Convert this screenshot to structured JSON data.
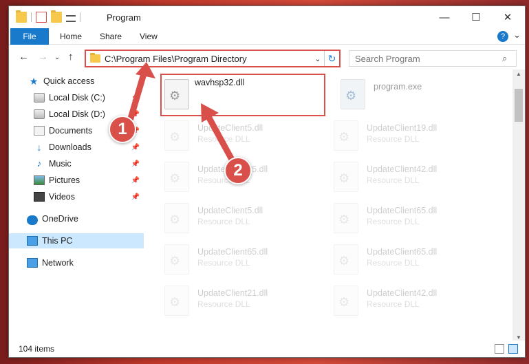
{
  "window": {
    "title": "Program",
    "minimize_glyph": "—",
    "maximize_glyph": "☐",
    "close_glyph": "✕"
  },
  "ribbon": {
    "tabs": [
      "File",
      "Home",
      "Share",
      "View"
    ],
    "expand_glyph": "⌄",
    "help_glyph": "?"
  },
  "navigation": {
    "back_glyph": "←",
    "forward_glyph": "→",
    "recent_glyph": "⌄",
    "up_glyph": "↑"
  },
  "address": {
    "path": "C:\\Program Files\\Program Directory",
    "dropdown_glyph": "⌄",
    "refresh_glyph": "↻"
  },
  "search": {
    "placeholder": "Search Program",
    "icon_glyph": "⌕"
  },
  "sidebar": {
    "items": [
      {
        "label": "Quick access",
        "icon": "star-icon",
        "pinned": false
      },
      {
        "label": "Local Disk (C:)",
        "icon": "disk-icon",
        "pinned": true
      },
      {
        "label": "Local Disk (D:)",
        "icon": "disk-icon",
        "pinned": true
      },
      {
        "label": "Documents",
        "icon": "documents-icon",
        "pinned": true
      },
      {
        "label": "Downloads",
        "icon": "downloads-icon",
        "pinned": true
      },
      {
        "label": "Music",
        "icon": "music-icon",
        "pinned": true
      },
      {
        "label": "Pictures",
        "icon": "pictures-icon",
        "pinned": true
      },
      {
        "label": "Videos",
        "icon": "videos-icon",
        "pinned": true
      },
      {
        "label": "OneDrive",
        "icon": "onedrive-icon",
        "pinned": false
      },
      {
        "label": "This PC",
        "icon": "this-pc-icon",
        "pinned": false,
        "selected": true
      },
      {
        "label": "Network",
        "icon": "network-icon",
        "pinned": false
      }
    ],
    "pin_glyph": "📌",
    "star_glyph": "★",
    "download_glyph": "↓",
    "music_glyph": "♪"
  },
  "files": {
    "highlighted": {
      "name": "wavhsp32.dll",
      "type": ""
    },
    "exe": {
      "name": "program.exe",
      "type": ""
    },
    "faded": [
      {
        "name": "UpdateClient5.dll",
        "type": "Resource DLL"
      },
      {
        "name": "UpdateClient19.dll",
        "type": "Resource DLL"
      },
      {
        "name": "UpdateClient65.dll",
        "type": "Resource DLL"
      },
      {
        "name": "UpdateClient42.dll",
        "type": "Resource DLL"
      },
      {
        "name": "UpdateClient5.dll",
        "type": "Resource DLL"
      },
      {
        "name": "UpdateClient65.dll",
        "type": "Resource DLL"
      },
      {
        "name": "UpdateClient65.dll",
        "type": "Resource DLL"
      },
      {
        "name": "UpdateClient65.dll",
        "type": "Resource DLL"
      },
      {
        "name": "UpdateClient21.dll",
        "type": "Resource DLL"
      },
      {
        "name": "UpdateClient42.dll",
        "type": "Resource DLL"
      }
    ],
    "gear_glyph": "⚙"
  },
  "status": {
    "item_count": "104 items"
  },
  "annotations": {
    "badge_1": "1",
    "badge_2": "2",
    "color": "#d9504b"
  },
  "colors": {
    "accent": "#1979ca",
    "highlight": "#d9504b",
    "selected_bg": "#cce8ff"
  }
}
